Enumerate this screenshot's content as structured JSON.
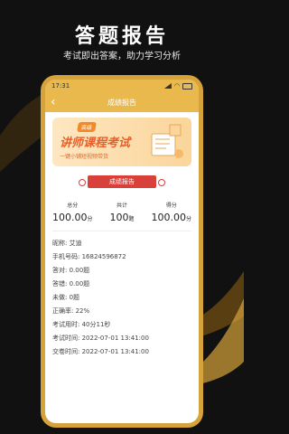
{
  "headline": "答题报告",
  "subline": "考试即出答案，助力学习分析",
  "status": {
    "time": "17:31"
  },
  "appbar": {
    "title": "成绩报告"
  },
  "banner": {
    "tag": "高级",
    "course": "讲师课程考试",
    "desc": "一键小铺短视频带货"
  },
  "report_label": "成绩报告",
  "stats": [
    {
      "label": "总分",
      "value": "100.00",
      "unit": "分"
    },
    {
      "label": "共计",
      "value": "100",
      "unit": "题"
    },
    {
      "label": "得分",
      "value": "100.00",
      "unit": "分"
    }
  ],
  "info": [
    {
      "label": "昵称:",
      "value": "艾迪"
    },
    {
      "label": "手机号码:",
      "value": "16824596872"
    },
    {
      "label": "答对:",
      "value": "0.00题"
    },
    {
      "label": "答错:",
      "value": "0.00题"
    },
    {
      "label": "未做:",
      "value": "0题"
    },
    {
      "label": "正确率:",
      "value": "22%"
    },
    {
      "label": "考试用时:",
      "value": "40分11秒"
    },
    {
      "label": "考试时间:",
      "value": "2022-07-01 13:41:00"
    },
    {
      "label": "交卷时间:",
      "value": "2022-07-01 13:41:00"
    }
  ],
  "colors": {
    "gold": "#e9b94e",
    "red": "#d9403a",
    "orange": "#e8602a"
  },
  "icons": [
    "back-arrow-icon",
    "signal-icon",
    "wifi-icon",
    "battery-icon"
  ]
}
